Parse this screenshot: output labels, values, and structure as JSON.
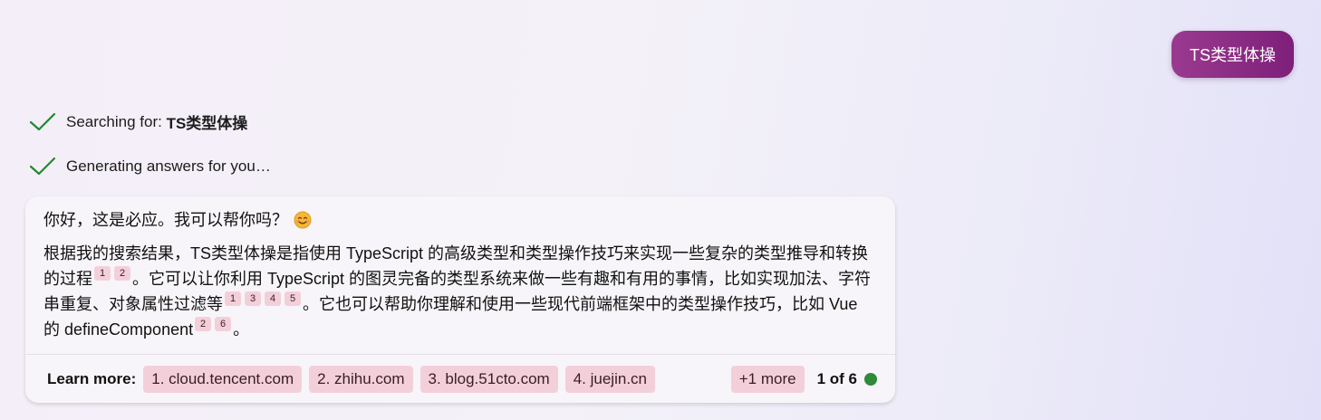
{
  "user_message": "TS类型体操",
  "status": {
    "searching_prefix": "Searching for: ",
    "searching_query": "TS类型体操",
    "generating": "Generating answers for you…"
  },
  "answer": {
    "greeting": "你好，这是必应。我可以帮你吗？",
    "p_seg1": "根据我的搜索结果，TS类型体操是指使用 TypeScript 的高级类型和类型操作技巧来实现一些复杂的类型推导和转换的过程",
    "p_seg2": "。它可以让你利用 TypeScript 的图灵完备的类型系统来做一些有趣和有用的事情，比如实现加法、字符串重复、对象属性过滤等",
    "p_seg3": "。它也可以帮助你理解和使用一些现代前端框架中的类型操作技巧，比如 Vue 的 defineComponent",
    "p_seg4": "。",
    "cites_a": [
      "1",
      "2"
    ],
    "cites_b": [
      "1",
      "3",
      "4",
      "5"
    ],
    "cites_c": [
      "2",
      "6"
    ]
  },
  "learn_more": {
    "label": "Learn more:",
    "sources": [
      "1. cloud.tencent.com",
      "2. zhihu.com",
      "3. blog.51cto.com",
      "4. juejin.cn"
    ],
    "more": "+1 more",
    "page_count": "1 of 6"
  },
  "colors": {
    "user_bubble": "#8a2a85",
    "check": "#1f8a2e",
    "chip_bg": "#f3d0d9",
    "status_dot": "#2f8a3a"
  },
  "icons": [
    "check-icon",
    "smiley-icon"
  ]
}
